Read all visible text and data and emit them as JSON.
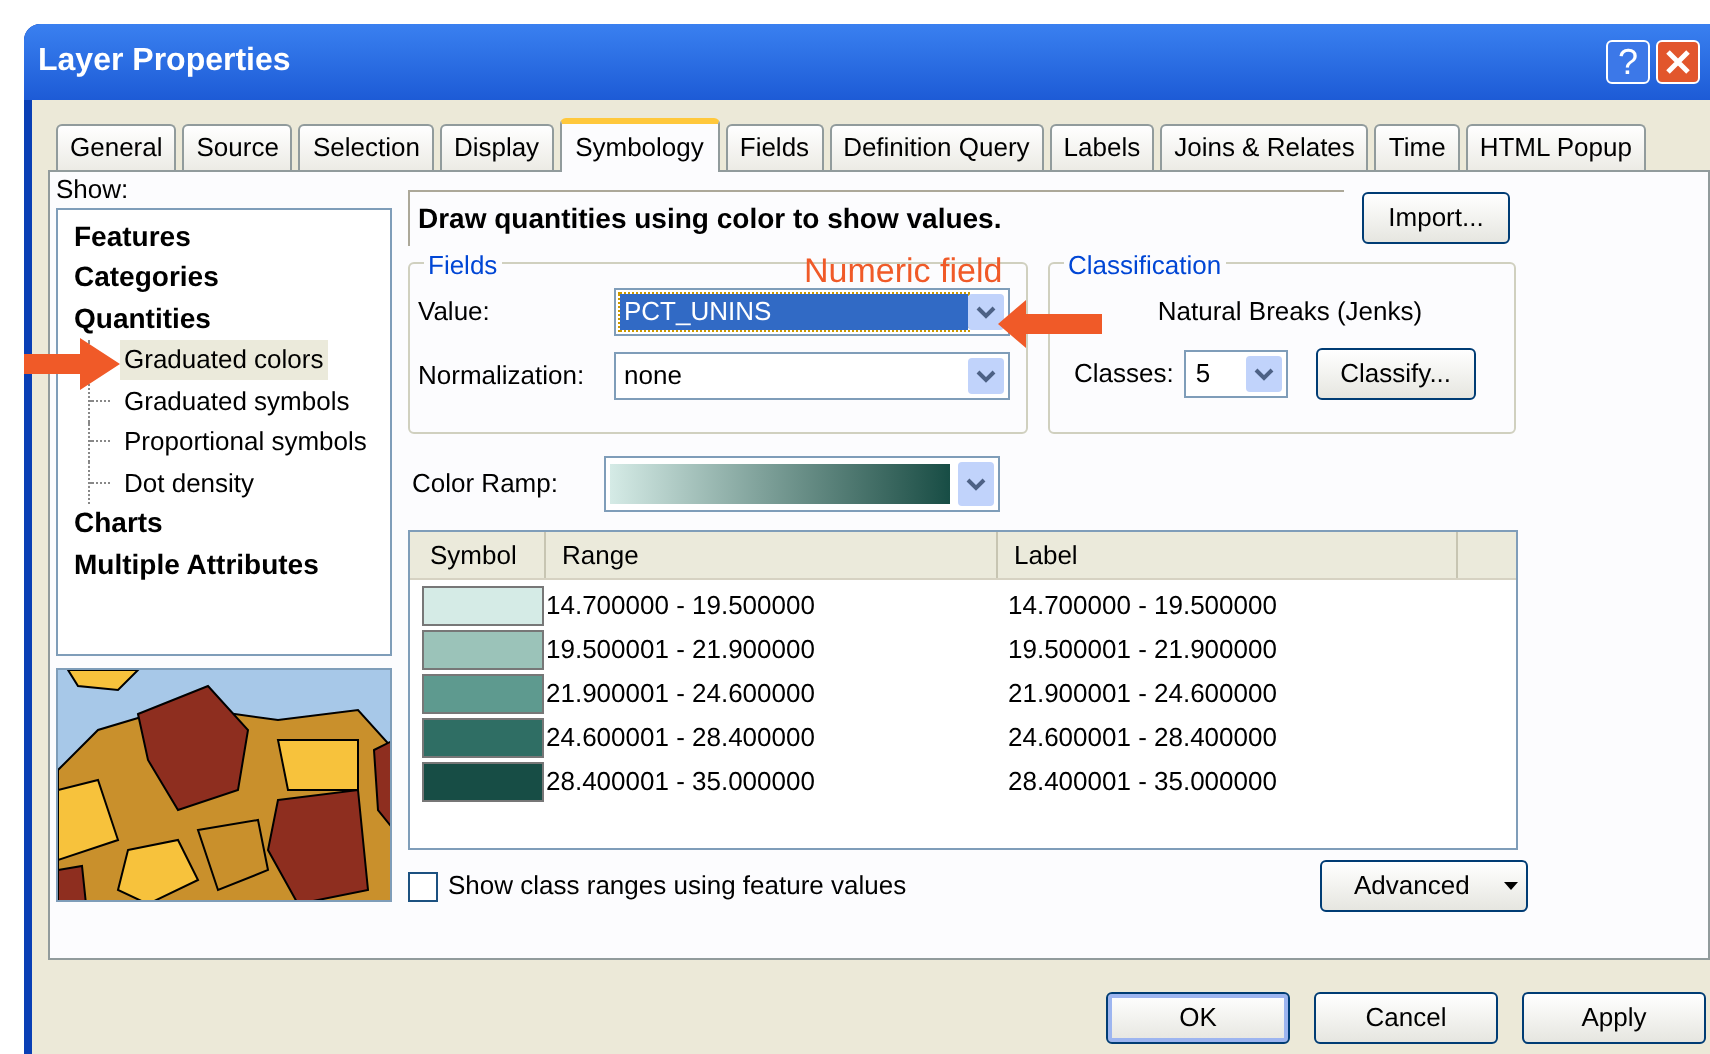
{
  "window": {
    "title": "Layer Properties"
  },
  "title_buttons": [
    {
      "kind": "help",
      "label": "?"
    },
    {
      "kind": "close"
    }
  ],
  "tabs": [
    {
      "label": "General",
      "selected": false
    },
    {
      "label": "Source",
      "selected": false
    },
    {
      "label": "Selection",
      "selected": false
    },
    {
      "label": "Display",
      "selected": false
    },
    {
      "label": "Symbology",
      "selected": true
    },
    {
      "label": "Fields",
      "selected": false
    },
    {
      "label": "Definition Query",
      "selected": false
    },
    {
      "label": "Labels",
      "selected": false
    },
    {
      "label": "Joins & Relates",
      "selected": false
    },
    {
      "label": "Time",
      "selected": false
    },
    {
      "label": "HTML Popup",
      "selected": false
    }
  ],
  "show_label": "Show:",
  "renderer_tree": [
    {
      "label": "Features",
      "selected": false
    },
    {
      "label": "Categories",
      "selected": false
    },
    {
      "label": "Quantities",
      "selected": false,
      "children": [
        {
          "label": "Graduated colors",
          "selected": true
        },
        {
          "label": "Graduated symbols",
          "selected": false
        },
        {
          "label": "Proportional symbols",
          "selected": false
        },
        {
          "label": "Dot density",
          "selected": false
        }
      ]
    },
    {
      "label": "Charts",
      "selected": false
    },
    {
      "label": "Multiple Attributes",
      "selected": false
    }
  ],
  "description": "Draw quantities using color to show values.",
  "import_button": "Import...",
  "fields": {
    "title": "Fields",
    "value_label": "Value:",
    "value": "PCT_UNINS",
    "value_selected": true,
    "normalization_label": "Normalization:",
    "normalization": "none"
  },
  "classification": {
    "title": "Classification",
    "method": "Natural Breaks (Jenks)",
    "classes_label": "Classes:",
    "classes": "5",
    "classify_button": "Classify..."
  },
  "color_ramp": {
    "label": "Color Ramp:"
  },
  "table": {
    "columns": [
      "Symbol",
      "Range",
      "Label"
    ],
    "rows": [
      {
        "color": "#d5ebe6",
        "range": "14.700000 - 19.500000",
        "label": "14.700000 - 19.500000"
      },
      {
        "color": "#9bc3b9",
        "range": "19.500001 - 21.900000",
        "label": "19.500001 - 21.900000"
      },
      {
        "color": "#5e9a8f",
        "range": "21.900001 - 24.600000",
        "label": "21.900001 - 24.600000"
      },
      {
        "color": "#2f6e64",
        "range": "24.600001 - 28.400000",
        "label": "24.600001 - 28.400000"
      },
      {
        "color": "#174d45",
        "range": "28.400001 - 35.000000",
        "label": "28.400001 - 35.000000"
      }
    ]
  },
  "show_class_ranges": {
    "label": "Show class ranges using feature values",
    "checked": false
  },
  "advanced_button": "Advanced",
  "buttons": [
    {
      "label": "OK",
      "default": true
    },
    {
      "label": "Cancel",
      "default": false
    },
    {
      "label": "Apply",
      "default": false
    }
  ],
  "annotations": [
    {
      "text": "Numeric field"
    }
  ]
}
